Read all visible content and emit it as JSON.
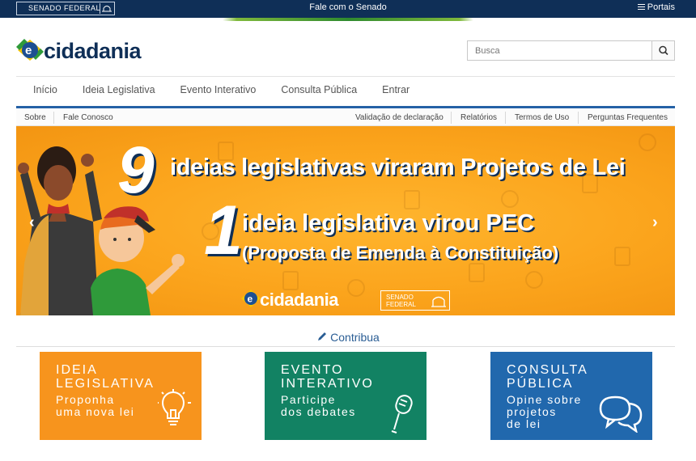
{
  "topbar": {
    "senado_label": "SENADO FEDERAL",
    "fale_label": "Fale com o Senado",
    "portais_label": "Portais"
  },
  "logo": {
    "text": "cidadania"
  },
  "search": {
    "placeholder": "Busca"
  },
  "nav": {
    "items": [
      "Início",
      "Ideia Legislativa",
      "Evento Interativo",
      "Consulta Pública",
      "Entrar"
    ]
  },
  "subnav": {
    "left": [
      "Sobre",
      "Fale Conosco"
    ],
    "right": [
      "Validação de declaração",
      "Relatórios",
      "Termos de Uso",
      "Perguntas Frequentes"
    ]
  },
  "banner": {
    "number1": "9",
    "line1": "ideias legislativas viraram Projetos de Lei",
    "number2": "1",
    "line2": "ideia legislativa virou PEC",
    "line3": "(Proposta de Emenda à Constituição)",
    "logo_text": "cidadania",
    "senado_label": "SENADO\nFEDERAL",
    "prev": "‹",
    "next": "›"
  },
  "contribua": {
    "label": "Contribua"
  },
  "cards": [
    {
      "title": "IDEIA\nLEGISLATIVA",
      "desc": "Proponha\numa nova lei",
      "color": "#f7941d",
      "icon": "lightbulb-icon"
    },
    {
      "title": "EVENTO\nINTERATIVO",
      "desc": "Participe\ndos debates",
      "color": "#128263",
      "icon": "microphone-icon"
    },
    {
      "title": "CONSULTA\nPÚBLICA",
      "desc": "Opine sobre\nprojetos\nde lei",
      "color": "#2168ad",
      "icon": "speech-bubbles-icon"
    }
  ]
}
